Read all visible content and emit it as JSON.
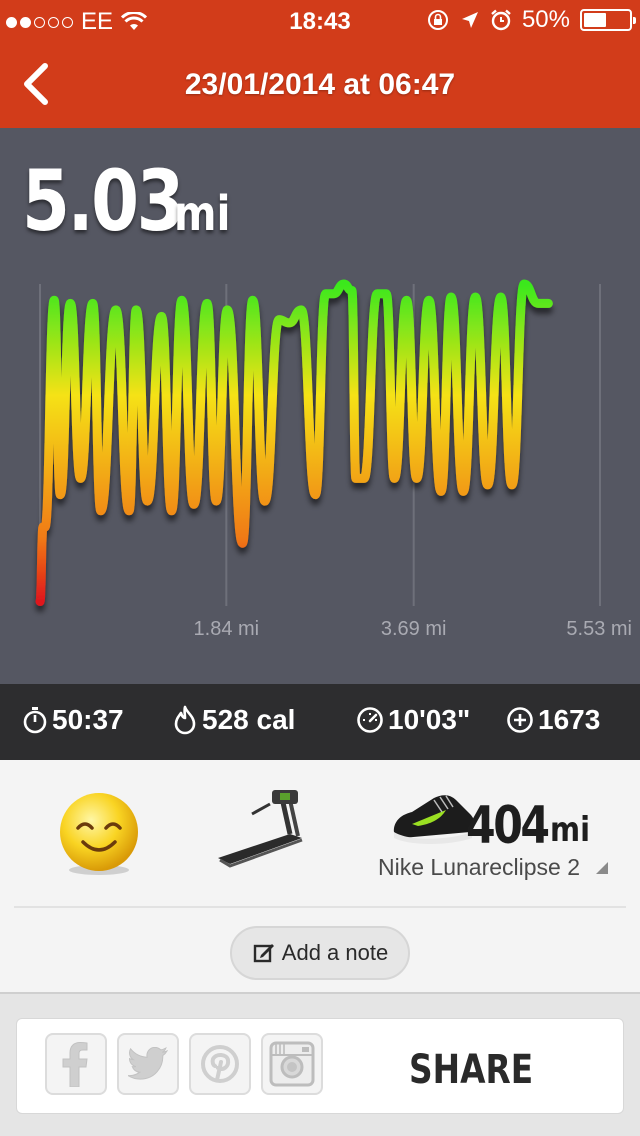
{
  "status_bar": {
    "carrier": "EE",
    "signal_bars": 2,
    "time": "18:43",
    "battery_percent": "50%",
    "battery_level": 0.5,
    "icons": [
      "wifi-icon",
      "rotation-lock-icon",
      "location-icon",
      "alarm-icon",
      "battery-icon"
    ]
  },
  "nav": {
    "back_icon": "chevron-left-icon",
    "title": "23/01/2014 at 06:47"
  },
  "run": {
    "distance_value": "5.03",
    "distance_unit": "mi"
  },
  "chart_data": {
    "type": "line",
    "title": "",
    "xlabel": "",
    "ylabel": "",
    "x_tick_labels": [
      "1.84 mi",
      "3.69 mi",
      "5.53 mi"
    ],
    "x_ticks_mi": [
      1.84,
      3.69,
      5.53
    ],
    "xlim_mi": [
      0,
      5.53
    ],
    "grid": "vertical",
    "color_gradient": [
      "#e0161c",
      "#f07a14",
      "#f5e214",
      "#3ae81e"
    ],
    "series": [
      {
        "x_mi": [
          0.0,
          0.03,
          0.05,
          0.14,
          0.2,
          0.3,
          0.4,
          0.52,
          0.6,
          0.75,
          0.88,
          0.95,
          1.06,
          1.2,
          1.3,
          1.4,
          1.52,
          1.65,
          1.74,
          1.85,
          2.0,
          2.1,
          2.22,
          2.36,
          2.46,
          2.58,
          2.72,
          2.82,
          2.9,
          3.0,
          3.08,
          3.12,
          3.2,
          3.33,
          3.42,
          3.5,
          3.62,
          3.72,
          3.84,
          3.96,
          4.06,
          4.18,
          4.3,
          4.42,
          4.55,
          4.66,
          4.78,
          4.92,
          5.02
        ],
        "y_relative": [
          0.02,
          0.25,
          0.25,
          0.95,
          0.35,
          0.94,
          0.4,
          0.94,
          0.3,
          0.92,
          0.3,
          0.92,
          0.33,
          0.9,
          0.3,
          0.95,
          0.32,
          0.94,
          0.33,
          0.92,
          0.2,
          0.95,
          0.33,
          0.89,
          0.88,
          0.92,
          0.35,
          0.97,
          0.97,
          1.0,
          0.98,
          0.4,
          0.4,
          0.97,
          0.97,
          0.4,
          0.95,
          0.4,
          0.95,
          0.36,
          0.96,
          0.36,
          0.96,
          0.38,
          0.96,
          0.38,
          1.0,
          0.94,
          0.94
        ]
      }
    ]
  },
  "stats": {
    "duration": "50:37",
    "duration_icon": "stopwatch-icon",
    "calories": "528 cal",
    "calories_icon": "flame-icon",
    "pace": "10'03\"",
    "pace_icon": "speedometer-icon",
    "fuel": "1673",
    "fuel_icon": "nikefuel-icon"
  },
  "details": {
    "mood_icon": "smiley-face-icon",
    "terrain_icon": "treadmill-icon",
    "shoe_icon": "running-shoe-icon",
    "shoe_mileage_value": "404",
    "shoe_mileage_unit": "mi",
    "shoe_name": "Nike Lunareclipse 2",
    "add_note_label": "Add a note",
    "add_note_icon": "edit-note-icon"
  },
  "share": {
    "buttons": [
      "facebook-icon",
      "twitter-icon",
      "pinterest-icon",
      "instagram-icon"
    ],
    "label": "SHARE"
  }
}
